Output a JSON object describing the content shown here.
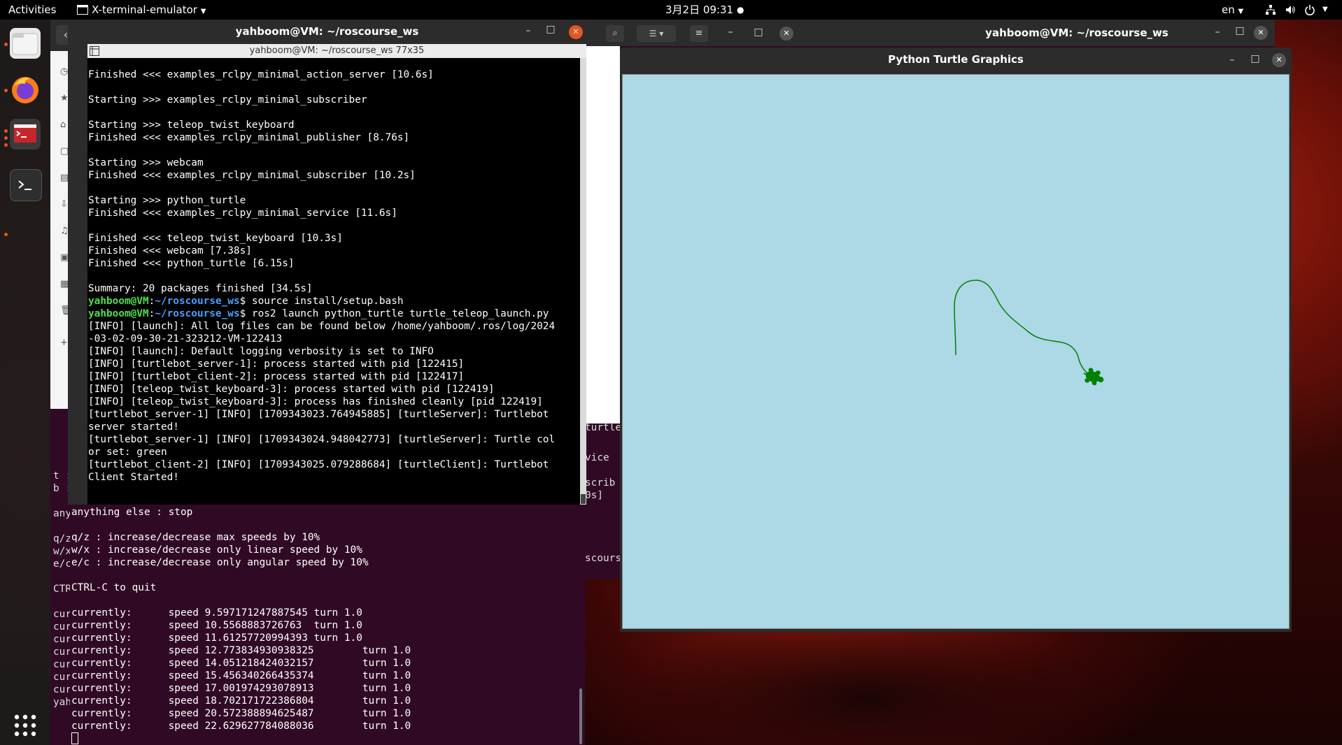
{
  "topbar": {
    "activities": "Activities",
    "app_name": "X-terminal-emulator",
    "clock": "3月2日  09:31",
    "lang": "en"
  },
  "file_manager": {
    "sidebar": [
      "Re",
      "St",
      "Ho",
      "De",
      "Do",
      "Do",
      "M",
      "Pi",
      "Vi",
      "Tr",
      "O"
    ],
    "partial_tail": "turtle_",
    "behind_text": [
      "vice",
      "scrib",
      "0s]",
      "scours"
    ]
  },
  "main_terminal": {
    "outer_title": "yahboom@VM: ~/roscourse_ws",
    "inner_title": "yahboom@VM: ~/roscourse_ws 77x35",
    "lines": [
      {
        "t": "Finished <<< examples_rclpy_minimal_action_server [10.6s]"
      },
      {
        "t": ""
      },
      {
        "t": "Starting >>> examples_rclpy_minimal_subscriber"
      },
      {
        "t": ""
      },
      {
        "t": "Starting >>> teleop_twist_keyboard"
      },
      {
        "t": "Finished <<< examples_rclpy_minimal_publisher [8.76s]"
      },
      {
        "t": ""
      },
      {
        "t": "Starting >>> webcam"
      },
      {
        "t": "Finished <<< examples_rclpy_minimal_subscriber [10.2s]"
      },
      {
        "t": ""
      },
      {
        "t": "Starting >>> python_turtle"
      },
      {
        "t": "Finished <<< examples_rclpy_minimal_service [11.6s]"
      },
      {
        "t": ""
      },
      {
        "t": "Finished <<< teleop_twist_keyboard [10.3s]"
      },
      {
        "t": "Finished <<< webcam [7.38s]"
      },
      {
        "t": "Finished <<< python_turtle [6.15s]"
      },
      {
        "t": ""
      },
      {
        "t": "Summary: 20 packages finished [34.5s]"
      },
      {
        "p": "yahboom@VM",
        "d": "~/roscourse_ws",
        "c": "source install/setup.bash"
      },
      {
        "p": "yahboom@VM",
        "d": "~/roscourse_ws",
        "c": "ros2 launch python_turtle turtle_teleop_launch.py"
      },
      {
        "t": "[INFO] [launch]: All log files can be found below /home/yahboom/.ros/log/2024"
      },
      {
        "t": "-03-02-09-30-21-323212-VM-122413"
      },
      {
        "t": "[INFO] [launch]: Default logging verbosity is set to INFO"
      },
      {
        "t": "[INFO] [turtlebot_server-1]: process started with pid [122415]"
      },
      {
        "t": "[INFO] [turtlebot_client-2]: process started with pid [122417]"
      },
      {
        "t": "[INFO] [teleop_twist_keyboard-3]: process started with pid [122419]"
      },
      {
        "t": "[INFO] [teleop_twist_keyboard-3]: process has finished cleanly [pid 122419]"
      },
      {
        "t": "[turtlebot_server-1] [INFO] [1709343023.764945885] [turtleServer]: Turtlebot"
      },
      {
        "t": "server started!"
      },
      {
        "t": "[turtlebot_server-1] [INFO] [1709343024.948042773] [turtleServer]: Turtle col"
      },
      {
        "t": "or set: green"
      },
      {
        "t": "[turtlebot_client-2] [INFO] [1709343025.079288684] [turtleClient]: Turtlebot"
      },
      {
        "t": "Client Started!"
      }
    ]
  },
  "bottom_terminal": {
    "left_fragments": [
      "t :",
      "b :",
      "",
      "any",
      "",
      "q/z",
      "w/x",
      "e/c",
      "",
      "CTRL",
      "",
      "curr",
      "curr",
      "curr",
      "curr",
      "curr",
      "curr",
      "curr",
      "yah"
    ],
    "lines": [
      "anything else : stop",
      "",
      "q/z : increase/decrease max speeds by 10%",
      "w/x : increase/decrease only linear speed by 10%",
      "e/c : increase/decrease only angular speed by 10%",
      "",
      "CTRL-C to quit",
      "",
      "currently:\tspeed 9.597171247887545 turn 1.0",
      "currently:\tspeed 10.5568883726763  turn 1.0",
      "currently:\tspeed 11.61257720994393 turn 1.0",
      "currently:\tspeed 12.773834930938325\tturn 1.0",
      "currently:\tspeed 14.051218424032157\tturn 1.0",
      "currently:\tspeed 15.456340266435374\tturn 1.0",
      "currently:\tspeed 17.001974293078913\tturn 1.0",
      "currently:\tspeed 18.702171722386804\tturn 1.0",
      "currently:\tspeed 20.572388894625487\tturn 1.0",
      "currently:\tspeed 22.629627784088036\tturn 1.0"
    ]
  },
  "back_terminal": {
    "title": "yahboom@VM: ~/roscourse_ws"
  },
  "turtle_window": {
    "title": "Python Turtle Graphics",
    "canvas_color": "#add8e6",
    "pen_color": "#008000",
    "turtle_color": "#008000"
  },
  "colors": {
    "prompt_user": "#4ee04e",
    "prompt_dir": "#4aa0ff",
    "close_orange": "#e95420",
    "terminal_purple": "#300a24"
  }
}
